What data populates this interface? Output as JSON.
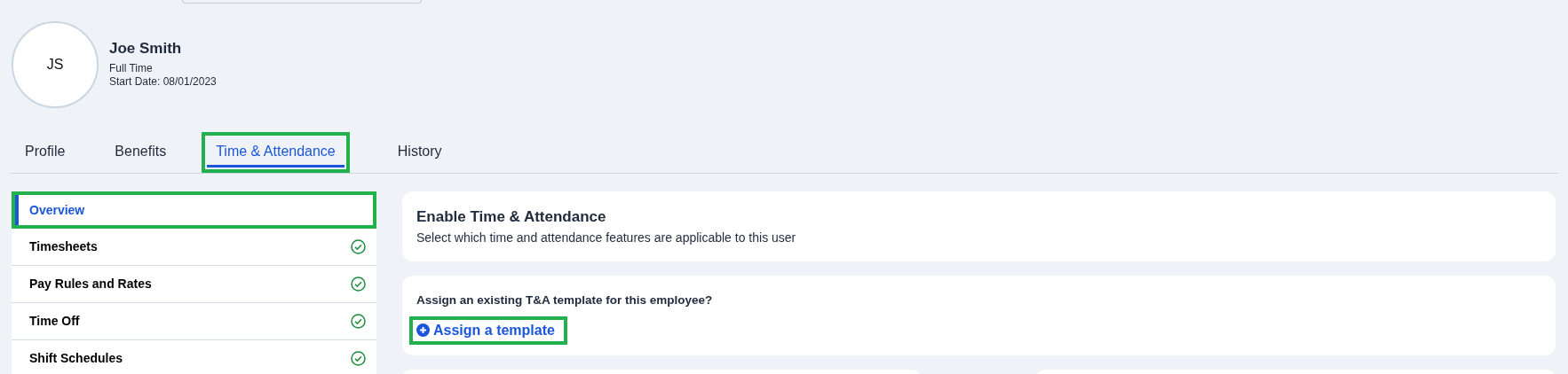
{
  "profile": {
    "initials": "JS",
    "name": "Joe Smith",
    "employment_type": "Full Time",
    "start_date": "Start Date: 08/01/2023"
  },
  "tabs": [
    {
      "label": "Profile",
      "selected": false,
      "highlighted": false
    },
    {
      "label": "Benefits",
      "selected": false,
      "highlighted": false
    },
    {
      "label": "Time & Attendance",
      "selected": true,
      "highlighted": true
    },
    {
      "label": "History",
      "selected": false,
      "highlighted": false
    }
  ],
  "sidebar": {
    "items": [
      {
        "label": "Overview",
        "selected": true,
        "highlighted": true,
        "complete": false
      },
      {
        "label": "Timesheets",
        "selected": false,
        "highlighted": false,
        "complete": true
      },
      {
        "label": "Pay Rules and Rates",
        "selected": false,
        "highlighted": false,
        "complete": true
      },
      {
        "label": "Time Off",
        "selected": false,
        "highlighted": false,
        "complete": true
      },
      {
        "label": "Shift Schedules",
        "selected": false,
        "highlighted": false,
        "complete": true
      }
    ]
  },
  "enable_card": {
    "title": "Enable Time & Attendance",
    "subtitle": "Select which time and attendance features are applicable to this user"
  },
  "template_card": {
    "question": "Assign an existing T&A template for this employee?",
    "action": {
      "label": "Assign a template",
      "highlighted": true
    }
  }
}
